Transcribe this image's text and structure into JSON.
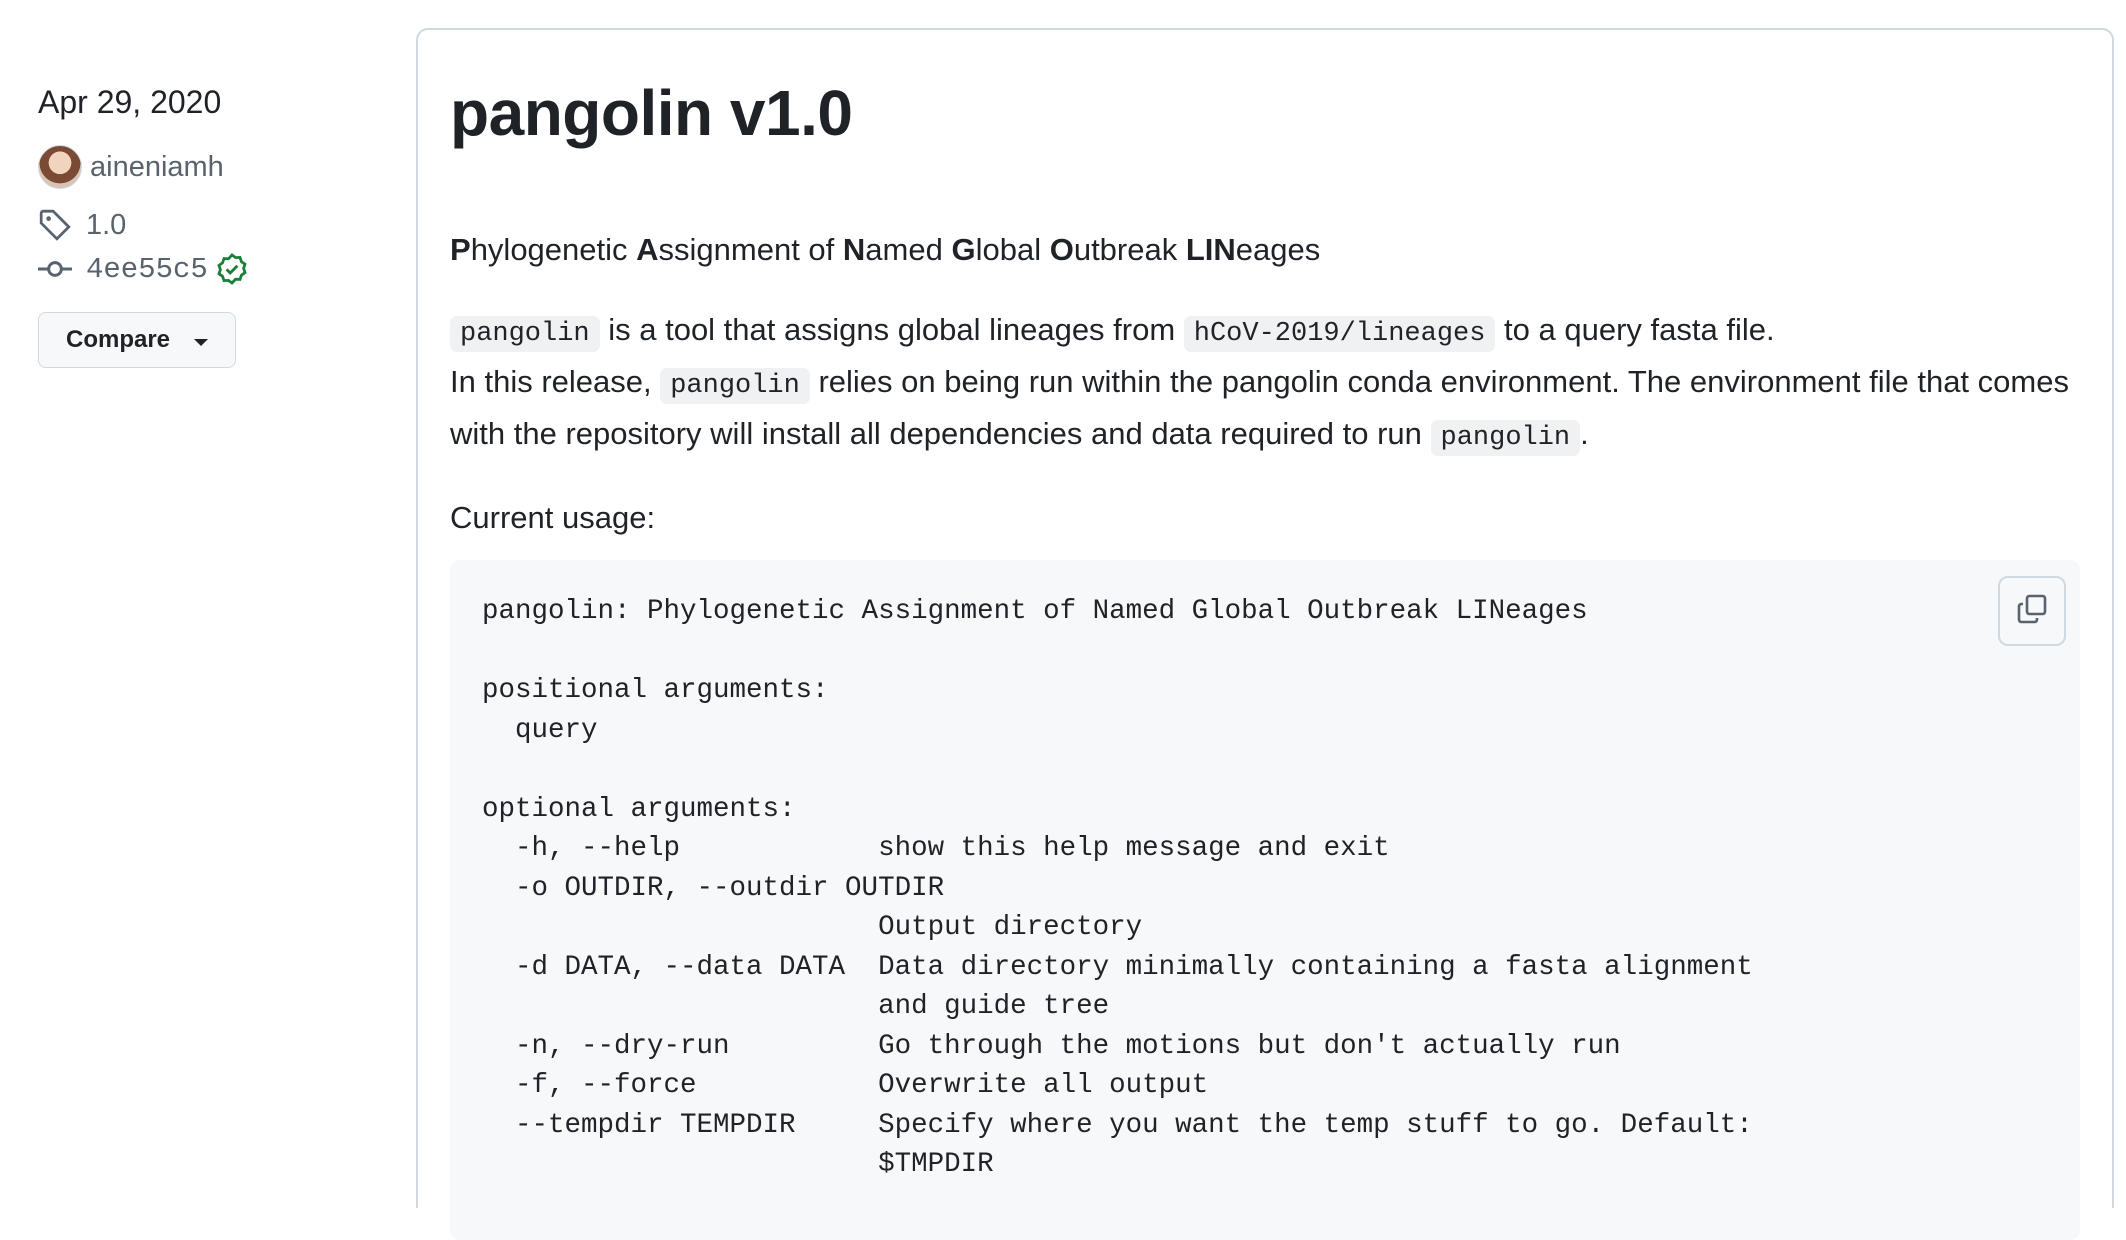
{
  "sidebar": {
    "date": "Apr 29, 2020",
    "author": "aineniamh",
    "tag": "1.0",
    "commit": "4ee55c5",
    "compare_label": "Compare"
  },
  "release": {
    "title": "pangolin v1.0",
    "acronym_parts": [
      {
        "b": "P",
        "t": "hylogenetic "
      },
      {
        "b": "A",
        "t": "ssignment of "
      },
      {
        "b": "N",
        "t": "amed "
      },
      {
        "b": "G",
        "t": "lobal "
      },
      {
        "b": "O",
        "t": "utbreak "
      },
      {
        "b": "LIN",
        "t": "eages"
      }
    ],
    "para1": {
      "code1": "pangolin",
      "text1": " is a tool that assigns global lineages from ",
      "code2": "hCoV-2019/lineages",
      "text2": " to a query fasta file."
    },
    "para2": {
      "text1": "In this release, ",
      "code1": "pangolin",
      "text2": " relies on being run within the pangolin conda environment. The environment file that comes with the repository will install all dependencies and data required to run ",
      "code2": "pangolin",
      "text3": "."
    },
    "usage_label": "Current usage:",
    "code_lines": [
      "pangolin: Phylogenetic Assignment of Named Global Outbreak LINeages",
      "",
      "positional arguments:",
      "  query",
      "",
      "optional arguments:",
      "  -h, --help            show this help message and exit",
      "  -o OUTDIR, --outdir OUTDIR",
      "                        Output directory",
      "  -d DATA, --data DATA  Data directory minimally containing a fasta alignment",
      "                        and guide tree",
      "  -n, --dry-run         Go through the motions but don't actually run",
      "  -f, --force           Overwrite all output",
      "  --tempdir TEMPDIR     Specify where you want the temp stuff to go. Default:",
      "                        $TMPDIR"
    ]
  },
  "icons": {
    "tag": "tag-icon",
    "commit": "git-commit-icon",
    "verified": "verified-check-icon",
    "copy": "copy-icon"
  },
  "colors": {
    "text": "#1f2328",
    "muted": "#59636e",
    "border": "#d1d9e0",
    "code_bg": "#f6f8fa",
    "verified": "#1a7f37"
  }
}
